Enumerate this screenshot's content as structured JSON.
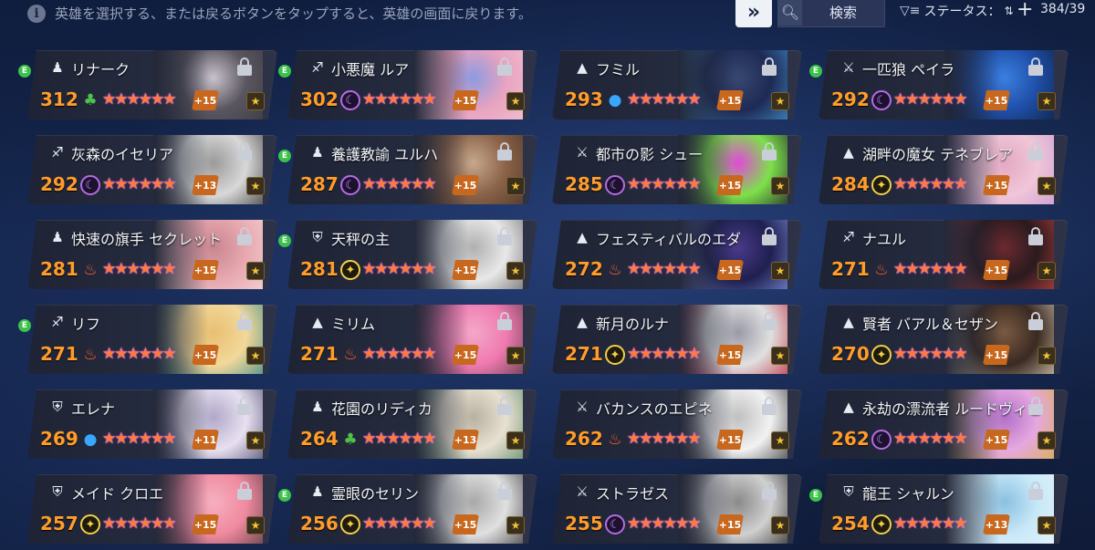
{
  "hint": "英雄を選択する、または戻るボタンをタップすると、英雄の画面に戻ります。",
  "toolbar": {
    "search_label": "検索",
    "status_label": "ステータス：",
    "count": "384/39"
  },
  "colors": {
    "level": "#ff9c2a",
    "plus_badge": "#c8681e",
    "e_badge": "#3cc24a"
  },
  "heroes": [
    {
      "name": "リナーク",
      "level": "312",
      "element": "earth",
      "plus": "+15",
      "class_icon": "hood-icon",
      "e": true,
      "portrait": [
        "#5a5660",
        "#c9c2cc",
        "#3b3942"
      ]
    },
    {
      "name": "小悪魔 ルア",
      "level": "302",
      "element": "dark",
      "plus": "+15",
      "class_icon": "bow-icon",
      "e": true,
      "portrait": [
        "#e9a3c0",
        "#8c9ae0",
        "#f0c3d2"
      ]
    },
    {
      "name": "フミル",
      "level": "293",
      "element": "water",
      "plus": "+15",
      "class_icon": "wizard-hat-icon",
      "e": false,
      "portrait": [
        "#1e2a55",
        "#37486f",
        "#3f90c8"
      ]
    },
    {
      "name": "一匹狼 ペイラ",
      "level": "292",
      "element": "dark",
      "plus": "+15",
      "class_icon": "blade-icon",
      "e": true,
      "portrait": [
        "#1f4fa8",
        "#3b7fe0",
        "#0d1f40"
      ]
    },
    {
      "name": "灰森のイセリア",
      "level": "292",
      "element": "dark",
      "plus": "+13",
      "class_icon": "bow-icon",
      "e": false,
      "portrait": [
        "#d8d8d8",
        "#9a9a9a",
        "#3a3a3a"
      ]
    },
    {
      "name": "養護教諭 ユルハ",
      "level": "287",
      "element": "dark",
      "plus": "+15",
      "class_icon": "hood-icon",
      "e": true,
      "portrait": [
        "#8a6248",
        "#c6a88d",
        "#4a3528"
      ]
    },
    {
      "name": "都市の影 シュー",
      "level": "285",
      "element": "dark",
      "plus": "+15",
      "class_icon": "blade-icon",
      "e": false,
      "portrait": [
        "#7ee04a",
        "#e04ad8",
        "#1b1b2a"
      ]
    },
    {
      "name": "湖畔の魔女 テネブレア",
      "level": "284",
      "element": "light",
      "plus": "+15",
      "class_icon": "wizard-hat-icon",
      "e": false,
      "portrait": [
        "#f0c6d8",
        "#e3a9c2",
        "#c89ad2"
      ]
    },
    {
      "name": "快速の旗手 セクレット",
      "level": "281",
      "element": "fire",
      "plus": "+15",
      "class_icon": "hood-icon",
      "e": false,
      "portrait": [
        "#e7a8b0",
        "#c9868f",
        "#f5d5d5"
      ]
    },
    {
      "name": "天秤の主",
      "level": "281",
      "element": "light",
      "plus": "+15",
      "class_icon": "guardian-icon",
      "e": true,
      "portrait": [
        "#e8e8e8",
        "#b0b0b0",
        "#6a6a6a"
      ]
    },
    {
      "name": "フェスティバルのエダ",
      "level": "272",
      "element": "fire",
      "plus": "+15",
      "class_icon": "wizard-hat-icon",
      "e": false,
      "portrait": [
        "#1f2050",
        "#4a3a8a",
        "#7c8ad8"
      ]
    },
    {
      "name": "ナユル",
      "level": "271",
      "element": "fire",
      "plus": "+15",
      "class_icon": "bow-icon",
      "e": false,
      "portrait": [
        "#2a1a1e",
        "#6a2a30",
        "#b84040"
      ]
    },
    {
      "name": "リフ",
      "level": "271",
      "element": "fire",
      "plus": "+15",
      "class_icon": "bow-icon",
      "e": true,
      "portrait": [
        "#f2d89a",
        "#e8bf72",
        "#3a8a8a"
      ]
    },
    {
      "name": "ミリム",
      "level": "271",
      "element": "fire",
      "plus": "+15",
      "class_icon": "wizard-hat-icon",
      "e": false,
      "portrait": [
        "#f07ab0",
        "#f3a8c8",
        "#5a3a48"
      ]
    },
    {
      "name": "新月のルナ",
      "level": "271",
      "element": "light",
      "plus": "+15",
      "class_icon": "wizard-hat-icon",
      "e": false,
      "portrait": [
        "#e0e0e0",
        "#9a9aa8",
        "#c03040"
      ]
    },
    {
      "name": "賢者 バアル＆セザン",
      "level": "270",
      "element": "light",
      "plus": "+15",
      "class_icon": "wizard-hat-icon",
      "e": false,
      "portrait": [
        "#3a2a22",
        "#7a5a42",
        "#d8c8b0"
      ]
    },
    {
      "name": "エレナ",
      "level": "269",
      "element": "water",
      "plus": "+11",
      "class_icon": "guardian-icon",
      "e": false,
      "portrait": [
        "#e8e0f0",
        "#b0a8c8",
        "#4a4a6a"
      ]
    },
    {
      "name": "花園のリディカ",
      "level": "264",
      "element": "earth",
      "plus": "+13",
      "class_icon": "hood-icon",
      "e": false,
      "portrait": [
        "#e8e0d0",
        "#b8b0a0",
        "#5a8a6a"
      ]
    },
    {
      "name": "バカンスのエピネ",
      "level": "262",
      "element": "fire",
      "plus": "+15",
      "class_icon": "blade-icon",
      "e": false,
      "portrait": [
        "#f2f2f2",
        "#c0c0c0",
        "#3a3a3a"
      ]
    },
    {
      "name": "永劫の漂流者 ルードヴィヒ",
      "level": "262",
      "element": "dark",
      "plus": "+15",
      "class_icon": "wizard-hat-icon",
      "e": false,
      "portrait": [
        "#e6a8e0",
        "#b070c8",
        "#d8b040"
      ]
    },
    {
      "name": "メイド クロエ",
      "level": "257",
      "element": "light",
      "plus": "+15",
      "class_icon": "guardian-icon",
      "e": false,
      "portrait": [
        "#f08aa0",
        "#f5b0c0",
        "#5a3a40"
      ]
    },
    {
      "name": "霊眼のセリン",
      "level": "256",
      "element": "light",
      "plus": "+15",
      "class_icon": "hood-icon",
      "e": true,
      "portrait": [
        "#e0e0e0",
        "#a8a8a8",
        "#3a3a3a"
      ]
    },
    {
      "name": "ストラゼス",
      "level": "255",
      "element": "dark",
      "plus": "+15",
      "class_icon": "blade-icon",
      "e": false,
      "portrait": [
        "#d0d0d0",
        "#8a8a8a",
        "#2a2a2a"
      ]
    },
    {
      "name": "龍王 シャルン",
      "level": "254",
      "element": "light",
      "plus": "+13",
      "class_icon": "guardian-icon",
      "e": true,
      "portrait": [
        "#c8e8f8",
        "#8ac0e0",
        "#e8f4fa"
      ]
    }
  ]
}
